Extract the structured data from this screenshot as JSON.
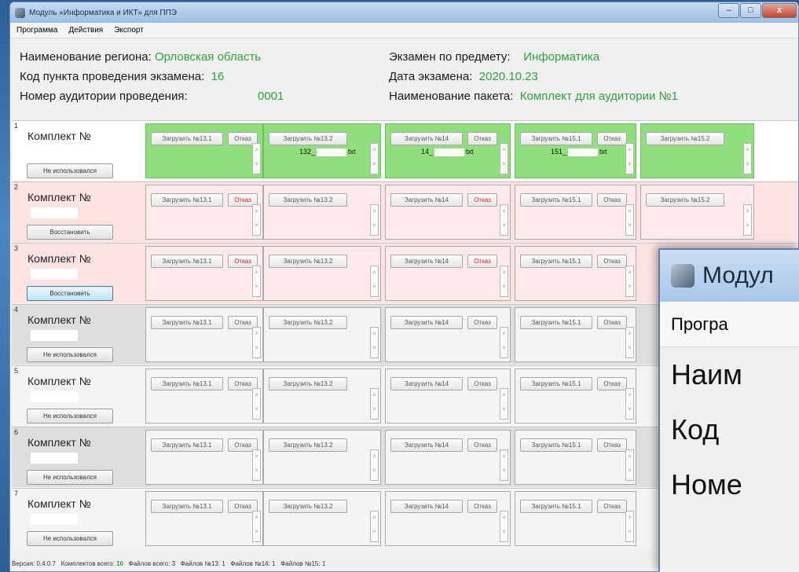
{
  "window": {
    "title": "Модуль «Информатика и ИКТ» для ППЭ",
    "minimize": "–",
    "maximize": "□",
    "close": "x"
  },
  "menu": [
    "Программа",
    "Действия",
    "Экспорт"
  ],
  "info": {
    "region_label": "Наименование региона:",
    "region_value": "Орловская область",
    "point_label": "Код пункта проведения экзамена:",
    "point_value": "16",
    "room_label": "Номер аудитории проведения:",
    "room_value": "0001",
    "subject_label": "Экзамен по предмету:",
    "subject_value": "Информатика",
    "date_label": "Дата экзамена:",
    "date_value": "2020.10.23",
    "package_label": "Наименование пакета:",
    "package_value": "Комплект для аудитории №1"
  },
  "kits": [
    {
      "num": "1",
      "title": "Комплект №",
      "action": "Не использовался",
      "state": "green",
      "slots": [
        {
          "load": "Загрузить №13.1",
          "refuse": "Отказ",
          "code": ""
        },
        {
          "load": "Загрузить №13.2",
          "refuse": "",
          "code_a": "132_",
          "code_b": "txt"
        },
        {
          "load": "Загрузить №14",
          "refuse": "Отказ",
          "code_a": "14_",
          "code_b": "txt"
        },
        {
          "load": "Загрузить №15.1",
          "refuse": "Отказ",
          "code_a": "151_",
          "code_b": "txt"
        },
        {
          "load": "Загрузить №15.2",
          "refuse": "",
          "code": ""
        }
      ]
    },
    {
      "num": "2",
      "title": "Комплект №",
      "action": "Восстановить",
      "state": "pink",
      "slots": [
        {
          "load": "Загрузить №13.1",
          "refuse": "Отказ"
        },
        {
          "load": "Загрузить №13.2",
          "refuse": ""
        },
        {
          "load": "Загрузить №14",
          "refuse": "Отказ"
        },
        {
          "load": "Загрузить №15.1",
          "refuse": "Отказ"
        },
        {
          "load": "Загрузить №15.2",
          "refuse": ""
        }
      ]
    },
    {
      "num": "3",
      "title": "Комплект №",
      "action": "Восстановить",
      "state": "pink",
      "slots": [
        {
          "load": "Загрузить №13.1",
          "refuse": "Отказ"
        },
        {
          "load": "Загрузить №13.2",
          "refuse": ""
        },
        {
          "load": "Загрузить №14",
          "refuse": "Отказ"
        },
        {
          "load": "Загрузить №15.1",
          "refuse": "Отказ"
        }
      ]
    },
    {
      "num": "4",
      "title": "Комплект №",
      "action": "Не использовался",
      "state": "grey",
      "slots": [
        {
          "load": "Загрузить №13.1",
          "refuse": "Отказ"
        },
        {
          "load": "Загрузить №13.2",
          "refuse": ""
        },
        {
          "load": "Загрузить №14",
          "refuse": "Отказ"
        },
        {
          "load": "Загрузить №15.1",
          "refuse": "Отказ"
        }
      ]
    },
    {
      "num": "5",
      "title": "Комплект №",
      "action": "Не использовался",
      "state": "white",
      "slots": [
        {
          "load": "Загрузить №13.1",
          "refuse": "Отказ"
        },
        {
          "load": "Загрузить №13.2",
          "refuse": ""
        },
        {
          "load": "Загрузить №14",
          "refuse": "Отказ"
        },
        {
          "load": "Загрузить №15.1",
          "refuse": "Отказ"
        }
      ]
    },
    {
      "num": "6",
      "title": "Комплект №",
      "action": "Не использовался",
      "state": "grey",
      "slots": [
        {
          "load": "Загрузить №13.1",
          "refuse": "Отказ"
        },
        {
          "load": "Загрузить №13.2",
          "refuse": ""
        },
        {
          "load": "Загрузить №14",
          "refuse": "Отказ"
        },
        {
          "load": "Загрузить №15.1",
          "refuse": "Отказ"
        }
      ]
    },
    {
      "num": "7",
      "title": "Комплект №",
      "action": "Не использовался",
      "state": "white",
      "slots": [
        {
          "load": "Загрузить №13.1",
          "refuse": "Отказ"
        },
        {
          "load": "Загрузить №13.2",
          "refuse": ""
        },
        {
          "load": "Загрузить №14",
          "refuse": "Отказ"
        },
        {
          "load": "Загрузить №15.1",
          "refuse": "Отказ"
        }
      ]
    }
  ],
  "status": {
    "version_label": "Версия:",
    "version": "0.4.0.7",
    "kits_label": "Комплектов всего:",
    "kits": "10",
    "files_label": "Файлов всего:",
    "files": "3",
    "f13_label": "Файлов №13:",
    "f13": "1",
    "f14_label": "Файлов №14:",
    "f14": "1",
    "f15_label": "Файлов №15:",
    "f15": "1"
  },
  "zoom": {
    "title": "Модул",
    "menu": "Програ",
    "line1": "Наим",
    "line2": "Код",
    "line3": "Номе"
  },
  "colors": {
    "accent_green": "#2ea33a",
    "used_green": "#8fe07c",
    "refused_pink": "#fde2e2",
    "refuse_red": "#d42020"
  }
}
